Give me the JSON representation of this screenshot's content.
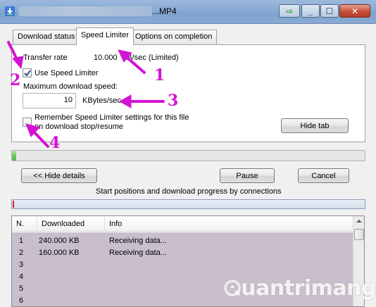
{
  "window": {
    "title_suffix": "...MP4",
    "controls": {
      "to_tray": "⇨",
      "minimize": "_",
      "maximize": "☐",
      "close": "✕"
    }
  },
  "tabs": [
    {
      "label": "Download status",
      "active": false
    },
    {
      "label": "Speed Limiter",
      "active": true
    },
    {
      "label": "Options on completion",
      "active": false
    }
  ],
  "speed_limiter": {
    "transfer_rate_label": "Transfer rate",
    "transfer_rate_value": "10.000",
    "transfer_rate_unit": "KB/sec  (Limited)",
    "use_limiter_label": "Use Speed Limiter",
    "use_limiter_checked": true,
    "max_speed_label": "Maximum download speed:",
    "max_speed_value": "10",
    "max_speed_unit": "KBytes/sec",
    "remember_label_line1": "Remember Speed Limiter settings for this file",
    "remember_label_line2": "on download stop/resume",
    "remember_checked": false,
    "hide_tab_label": "Hide tab"
  },
  "overall_progress": {
    "fraction": 0.0
  },
  "actions": {
    "hide_details_label": "<< Hide details",
    "pause_label": "Pause",
    "cancel_label": "Cancel"
  },
  "connections": {
    "caption": "Start positions and download progress by connections",
    "columns": [
      "N.",
      "Downloaded",
      "Info"
    ],
    "rows": [
      {
        "n": "1",
        "downloaded": "240.000  KB",
        "info": "Receiving data..."
      },
      {
        "n": "2",
        "downloaded": "160.000  KB",
        "info": "Receiving data..."
      },
      {
        "n": "3",
        "downloaded": "",
        "info": ""
      },
      {
        "n": "4",
        "downloaded": "",
        "info": ""
      },
      {
        "n": "5",
        "downloaded": "",
        "info": ""
      },
      {
        "n": "6",
        "downloaded": "",
        "info": ""
      }
    ]
  },
  "annotations": {
    "n1": "1",
    "n2": "2",
    "n3": "3",
    "n4": "4",
    "color": "#d412d4"
  },
  "watermark": {
    "text": "uantrimang",
    "icon": "q-logo-icon"
  }
}
